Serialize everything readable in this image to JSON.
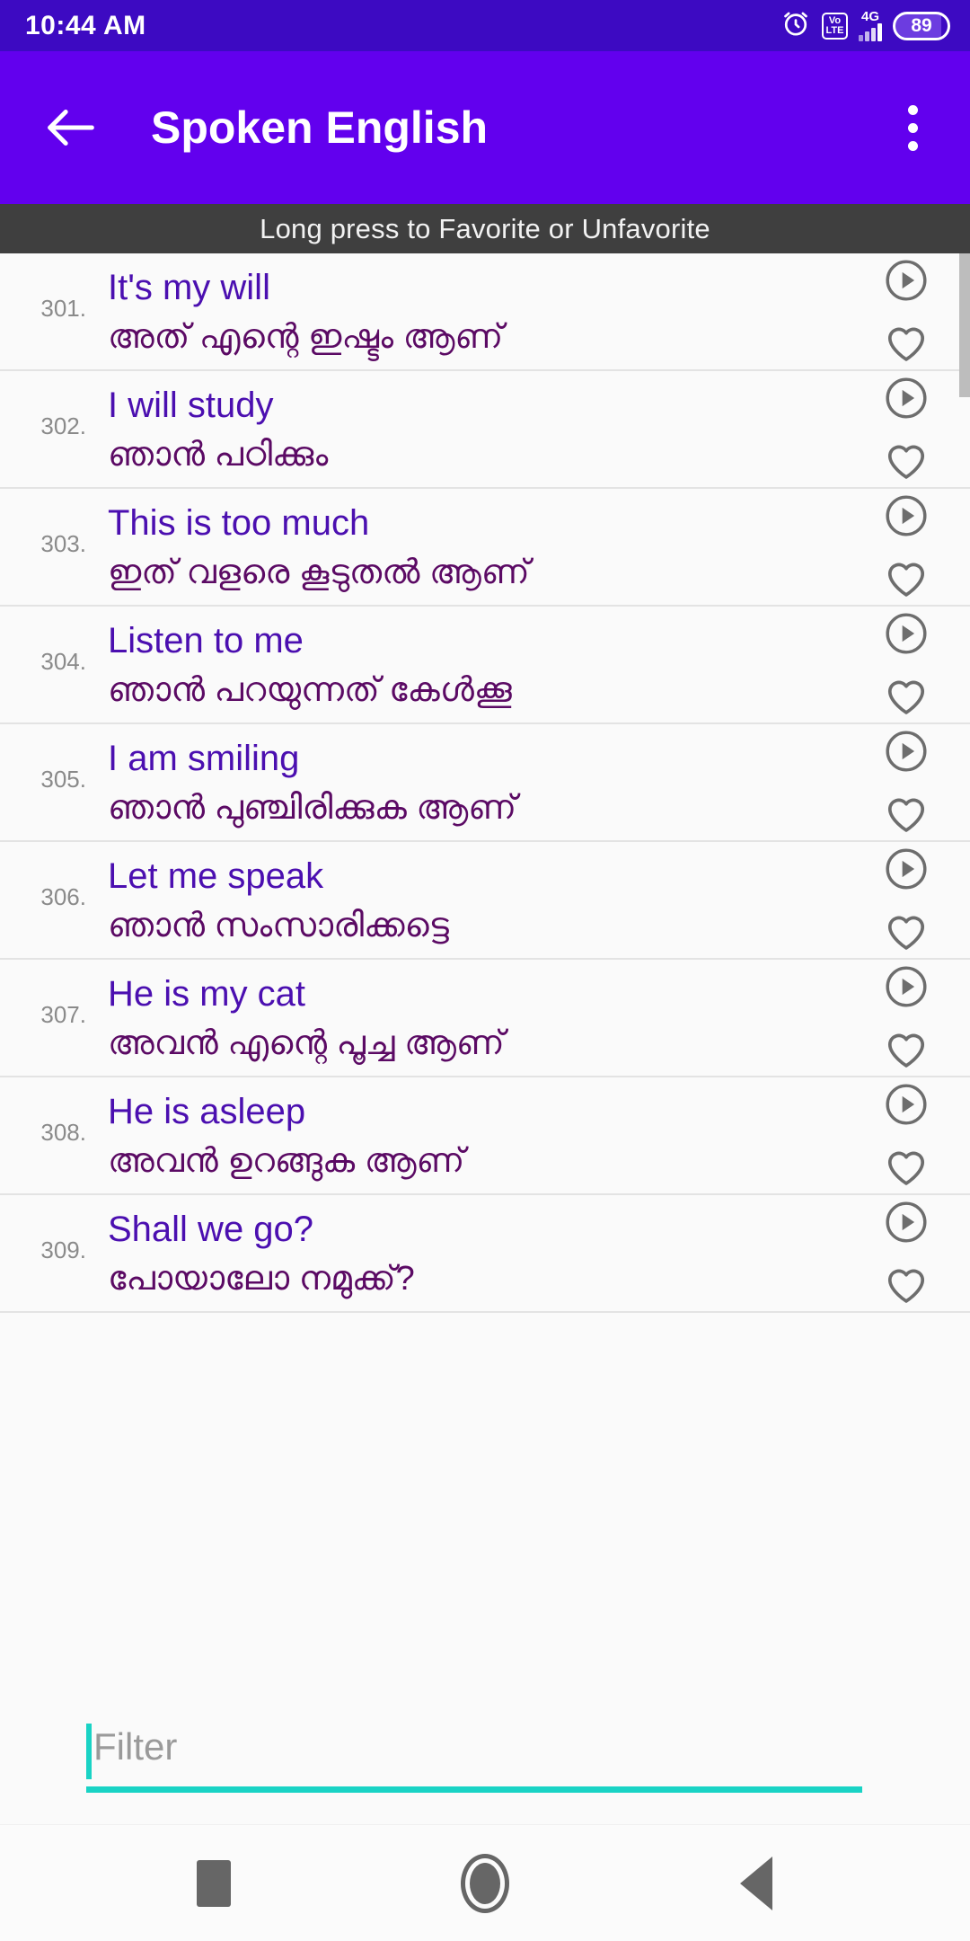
{
  "status_bar": {
    "time": "10:44 AM",
    "alarm_icon": "alarm-icon",
    "volte_top": "Vo",
    "volte_bottom": "LTE",
    "network_label": "4G",
    "battery_level": "89"
  },
  "app_bar": {
    "back_label": "back-arrow",
    "title": "Spoken English",
    "overflow_label": "more-options"
  },
  "hint_bar": {
    "text": "Long press to Favorite or Unfavorite"
  },
  "list": {
    "play_icon": "play-circle-icon",
    "favorite_icon": "heart-outline-icon",
    "items": [
      {
        "number": "301.",
        "english": "It's my will",
        "malayalam": "അത് എന്റെ ഇഷ്ടം ആണ്"
      },
      {
        "number": "302.",
        "english": "I will study",
        "malayalam": "ഞാൻ പഠിക്കും"
      },
      {
        "number": "303.",
        "english": "This is too much",
        "malayalam": "ഇത് വളരെ കൂടുതൽ ആണ്"
      },
      {
        "number": "304.",
        "english": "Listen to me",
        "malayalam": "ഞാൻ പറയുന്നത് കേൾക്കൂ"
      },
      {
        "number": "305.",
        "english": "I am smiling",
        "malayalam": "ഞാൻ പുഞ്ചിരിക്കുക ആണ്"
      },
      {
        "number": "306.",
        "english": "Let me speak",
        "malayalam": "ഞാൻ സംസാരിക്കട്ടെ"
      },
      {
        "number": "307.",
        "english": "He is my cat",
        "malayalam": "അവൻ എന്റെ പൂച്ച ആണ്"
      },
      {
        "number": "308.",
        "english": "He is asleep",
        "malayalam": "അവൻ ഉറങ്ങുക ആണ്"
      },
      {
        "number": "309.",
        "english": "Shall we go?",
        "malayalam": "പോയാലോ നമുക്ക്?"
      }
    ]
  },
  "filter": {
    "placeholder": "Filter",
    "value": ""
  },
  "nav_bar": {
    "recents_label": "recents-button",
    "home_label": "home-button",
    "back_label": "back-button"
  },
  "colors": {
    "status_bar": "#3d0ac2",
    "app_bar": "#6200ee",
    "hint_bar": "#3f3f3f",
    "english_text": "#4b0fb0",
    "malayalam_text": "#5b0a64",
    "accent": "#19d3c5"
  }
}
